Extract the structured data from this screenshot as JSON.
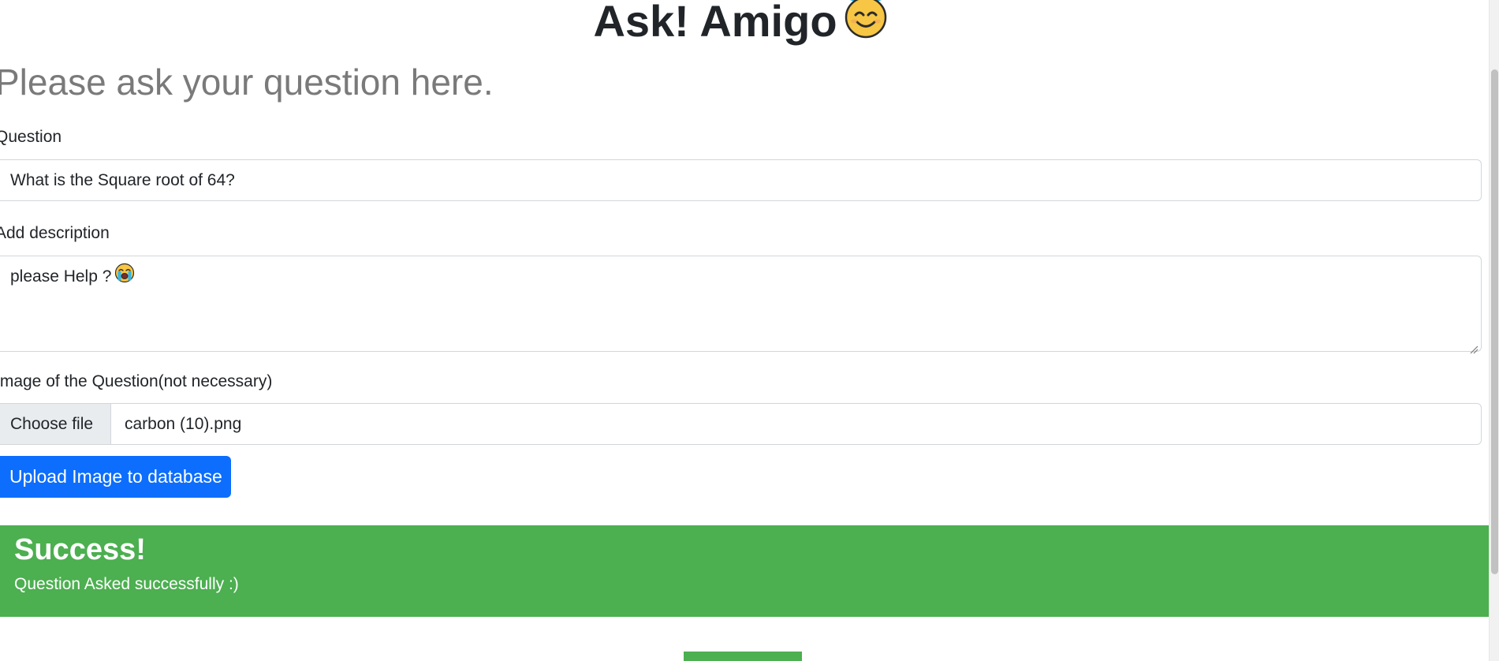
{
  "header": {
    "title": "Ask! Amigo",
    "title_emoji_icon": "smiling-face-with-halo-icon"
  },
  "form": {
    "heading": "Please ask your question here.",
    "question": {
      "label": "Question",
      "value": "What is the Square root of 64?"
    },
    "description": {
      "label": "Add description",
      "value": "please Help ?",
      "emoji_icon": "loudly-crying-face-icon"
    },
    "image": {
      "label": "Image of the Question(not necessary)",
      "choose_label": "Choose file",
      "file_name": "carbon (10).png"
    },
    "upload_label": "Upload Image to database"
  },
  "alert": {
    "title": "Success!",
    "message": "Question Asked successfully :)",
    "color": "#4caf50"
  },
  "colors": {
    "primary": "#0d6efd",
    "success": "#4caf50",
    "muted_heading": "#7a7a7a"
  }
}
